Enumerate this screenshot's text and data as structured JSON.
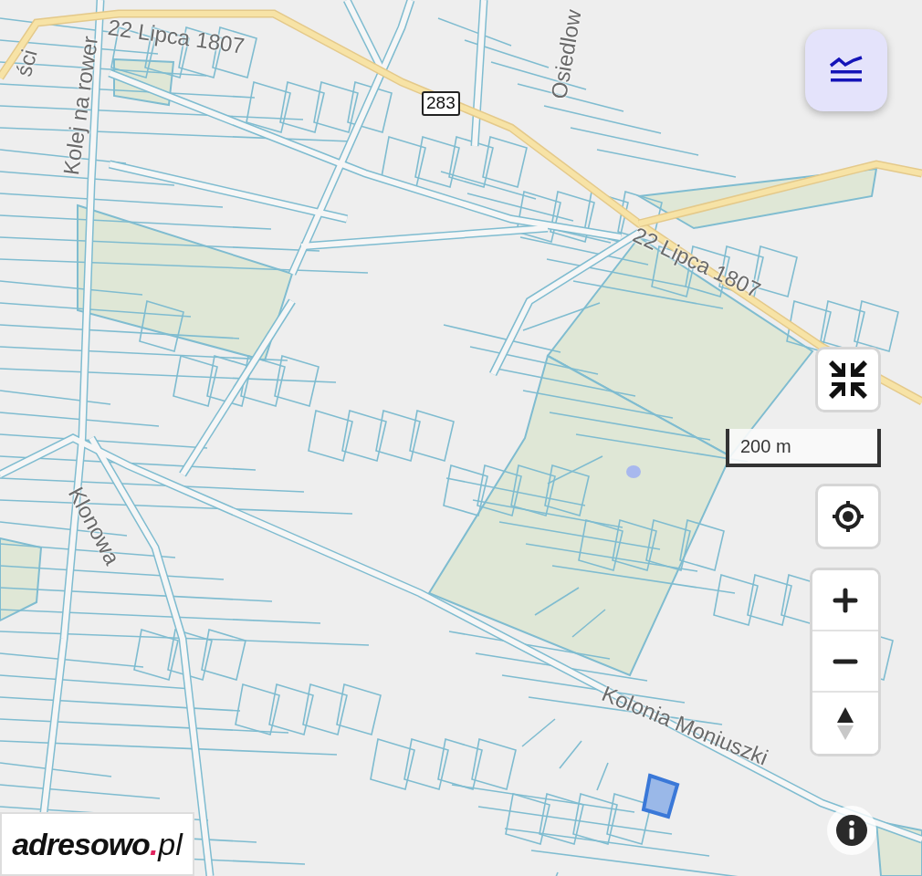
{
  "map": {
    "labels": [
      {
        "kind": "street",
        "text": "22 Lipca 1807"
      },
      {
        "kind": "route",
        "text": "283"
      },
      {
        "kind": "street",
        "text": "Osiedlow"
      },
      {
        "kind": "street",
        "text": "ści"
      },
      {
        "kind": "street",
        "text": "Kolej na rower"
      },
      {
        "kind": "street",
        "text": "22 Lipca 1807"
      },
      {
        "kind": "street",
        "text": "Klonowa"
      },
      {
        "kind": "street",
        "text": "Kolonia Moniuszki"
      }
    ]
  },
  "scale": {
    "text": "200 m"
  },
  "logo": {
    "name": "adresowo",
    "dot": ".",
    "tld": "pl"
  }
}
